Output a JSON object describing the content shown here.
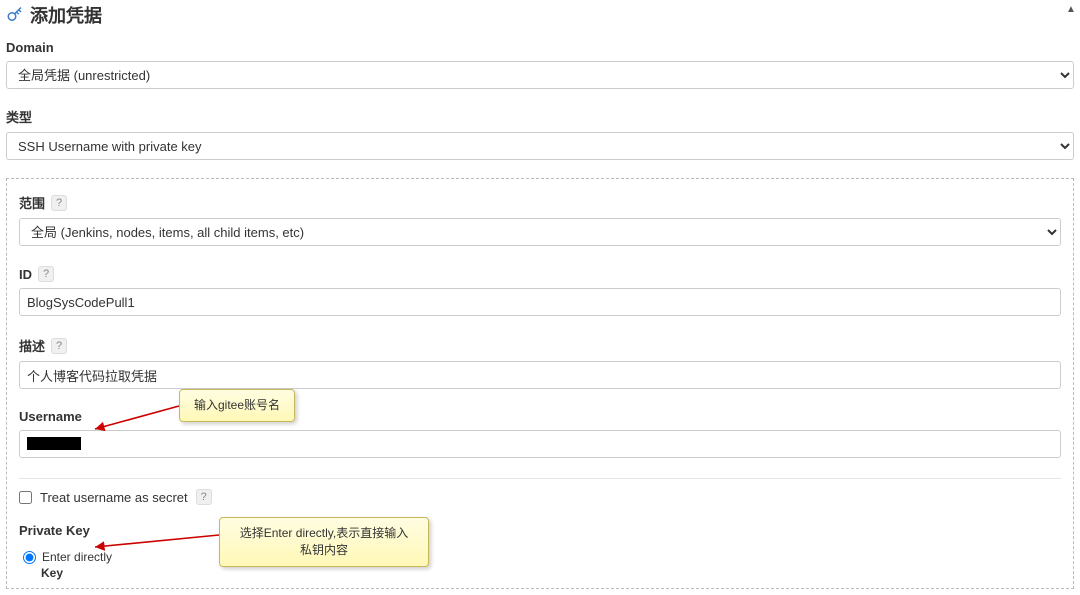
{
  "page": {
    "title": "添加凭据"
  },
  "domain": {
    "label": "Domain",
    "value": "全局凭据 (unrestricted)"
  },
  "type": {
    "label": "类型",
    "value": "SSH Username with private key"
  },
  "scope": {
    "label": "范围",
    "value": "全局 (Jenkins, nodes, items, all child items, etc)"
  },
  "id": {
    "label": "ID",
    "value": "BlogSysCodePull1"
  },
  "description": {
    "label": "描述",
    "value": "个人博客代码拉取凭据"
  },
  "username": {
    "label": "Username",
    "value": ""
  },
  "treatSecret": {
    "label": "Treat username as secret"
  },
  "privateKey": {
    "label": "Private Key",
    "radioLabel": "Enter directly",
    "keyLabel": "Key"
  },
  "annotations": {
    "username": "输入gitee账号名",
    "privateKey": "选择Enter directly,表示直接输入私钥内容"
  },
  "help": "?"
}
